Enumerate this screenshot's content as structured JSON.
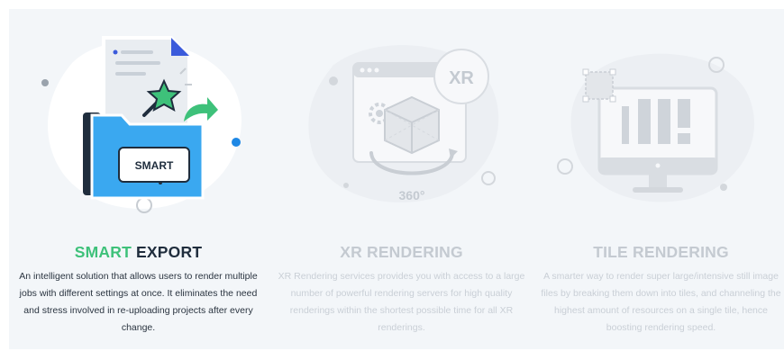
{
  "features": [
    {
      "title_highlight": "SMART",
      "title_rest": " EXPORT",
      "description": "An intelligent solution that allows users to render multiple jobs with different settings at once. It eliminates the need and stress involved in re-uploading projects after every change.",
      "icon_label": "SMART",
      "active": true
    },
    {
      "title": "XR RENDERING",
      "description": "XR Rendering services provides you with access to a large number of powerful rendering servers for high quality renderings within the shortest possible time for all XR renderings.",
      "badge": "XR",
      "degree_label": "360°",
      "active": false
    },
    {
      "title": "TILE RENDERING",
      "description": "A smarter way to render super large/intensive still image files by breaking them down into tiles, and channeling the highest amount of resources on a single tile, hence boosting rendering speed.",
      "active": false
    }
  ],
  "colors": {
    "accent_green": "#3ec17a",
    "accent_blue": "#1e88e5",
    "folder_blue": "#3aa8f0",
    "dark_navy": "#1f2d3d",
    "panel_bg": "#f3f6f9"
  }
}
